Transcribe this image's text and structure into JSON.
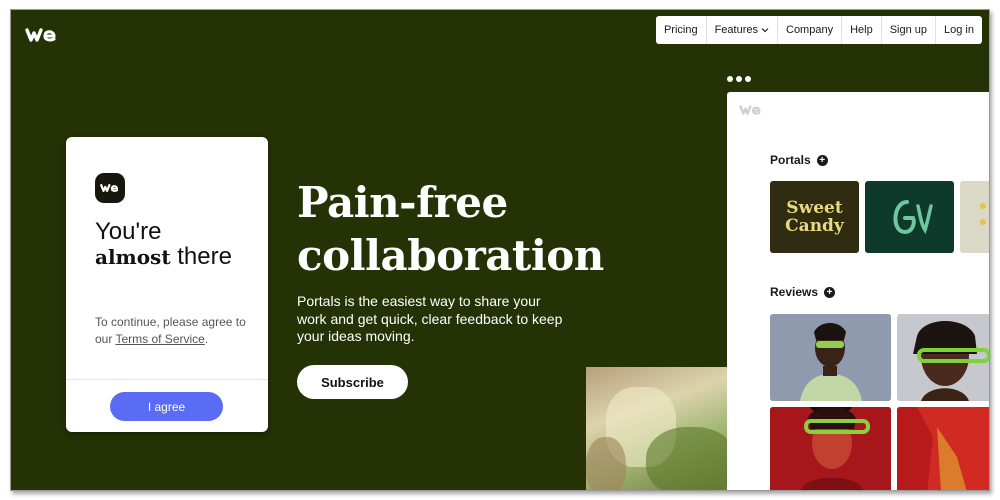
{
  "nav": {
    "items": [
      "Pricing",
      "Features",
      "Company",
      "Help",
      "Sign up",
      "Log in"
    ]
  },
  "consent": {
    "title_line1": "You're",
    "title_bold": "almost",
    "title_rest": " there",
    "text_prefix": "To continue, please agree to our ",
    "terms_link": "Terms of Service",
    "text_suffix": ".",
    "button": "I agree"
  },
  "hero": {
    "title_line1": "Pain-free",
    "title_line2": "collaboration",
    "subtitle": "Portals is the easiest way to share your work and get quick, clear feedback to keep your ideas moving.",
    "cta": "Subscribe"
  },
  "preview": {
    "portals_title": "Portals",
    "portal_tile_text": "Sweet Candy",
    "reviews_title": "Reviews"
  },
  "colors": {
    "background": "#253206",
    "button_accent": "#5a6cf3"
  }
}
